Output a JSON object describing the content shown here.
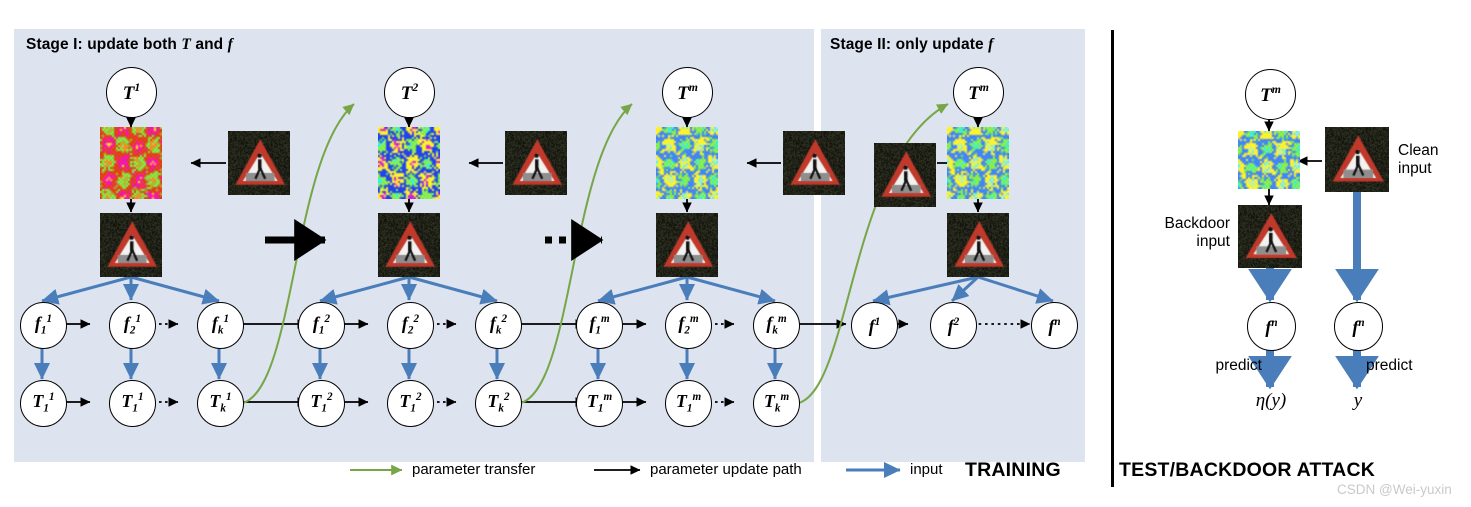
{
  "figure": {
    "background": "#ffffff",
    "panel_color": "#dde3ef",
    "green": "#76a646",
    "blue": "#4a7ebb",
    "black": "#000000"
  },
  "stages": [
    {
      "id": "stage1",
      "title_prefix": "Stage I: update both ",
      "title_sym1": "T",
      "title_mid": " and ",
      "title_sym2": "f"
    },
    {
      "id": "stage2",
      "title_prefix": "Stage II: only update ",
      "title_sym1": "f",
      "title_mid": "",
      "title_sym2": ""
    }
  ],
  "trigger_nodes": [
    {
      "base": "T",
      "sup": "1"
    },
    {
      "base": "T",
      "sup": "2"
    },
    {
      "base": "T",
      "sup": "m"
    },
    {
      "base": "T",
      "sup": "m"
    }
  ],
  "groups": [
    {
      "id": "group-1",
      "f_row": [
        {
          "base": "f",
          "sub": "1",
          "sup": "1"
        },
        {
          "base": "f",
          "sub": "2",
          "sup": "1"
        },
        {
          "base": "f",
          "sub": "k",
          "sup": "1"
        }
      ],
      "t_row": [
        {
          "base": "T",
          "sub": "1",
          "sup": "1"
        },
        {
          "base": "T",
          "sub": "1",
          "sup": "1"
        },
        {
          "base": "T",
          "sub": "k",
          "sup": "1"
        }
      ]
    },
    {
      "id": "group-2",
      "f_row": [
        {
          "base": "f",
          "sub": "1",
          "sup": "2"
        },
        {
          "base": "f",
          "sub": "2",
          "sup": "2"
        },
        {
          "base": "f",
          "sub": "k",
          "sup": "2"
        }
      ],
      "t_row": [
        {
          "base": "T",
          "sub": "1",
          "sup": "2"
        },
        {
          "base": "T",
          "sub": "1",
          "sup": "2"
        },
        {
          "base": "T",
          "sub": "k",
          "sup": "2"
        }
      ]
    },
    {
      "id": "group-m",
      "f_row": [
        {
          "base": "f",
          "sub": "1",
          "sup": "m"
        },
        {
          "base": "f",
          "sub": "2",
          "sup": "m"
        },
        {
          "base": "f",
          "sub": "k",
          "sup": "m"
        }
      ],
      "t_row": [
        {
          "base": "T",
          "sub": "1",
          "sup": "m"
        },
        {
          "base": "T",
          "sub": "1",
          "sup": "m"
        },
        {
          "base": "T",
          "sub": "k",
          "sup": "m"
        }
      ]
    }
  ],
  "stage2_f_row": [
    {
      "base": "f",
      "sup": "1"
    },
    {
      "base": "f",
      "sup": "2"
    },
    {
      "base": "f",
      "sup": "n"
    }
  ],
  "legend": [
    {
      "key": "parameter-transfer",
      "label": "parameter transfer",
      "color": "#76a646"
    },
    {
      "key": "parameter-update-path",
      "label": "parameter update path",
      "color": "#000000"
    },
    {
      "key": "input",
      "label": "input",
      "color": "#4a7ebb"
    }
  ],
  "captions": {
    "training": "TRAINING",
    "test": "TEST/BACKDOOR ATTACK"
  },
  "right_panel": {
    "trigger_node": {
      "base": "T",
      "sup": "m"
    },
    "clean_input_label": "Clean\ninput",
    "clean_input_line1": "Clean",
    "clean_input_line2": "input",
    "backdoor_input_line1": "Backdoor",
    "backdoor_input_line2": "input",
    "f_backdoor": {
      "base": "f",
      "sup": "n"
    },
    "f_clean": {
      "base": "f",
      "sup": "n"
    },
    "predict_left": "predict",
    "predict_right": "predict",
    "out_backdoor": "η(y)",
    "out_clean": "y"
  },
  "watermark": "CSDN @Wei-yuxin"
}
